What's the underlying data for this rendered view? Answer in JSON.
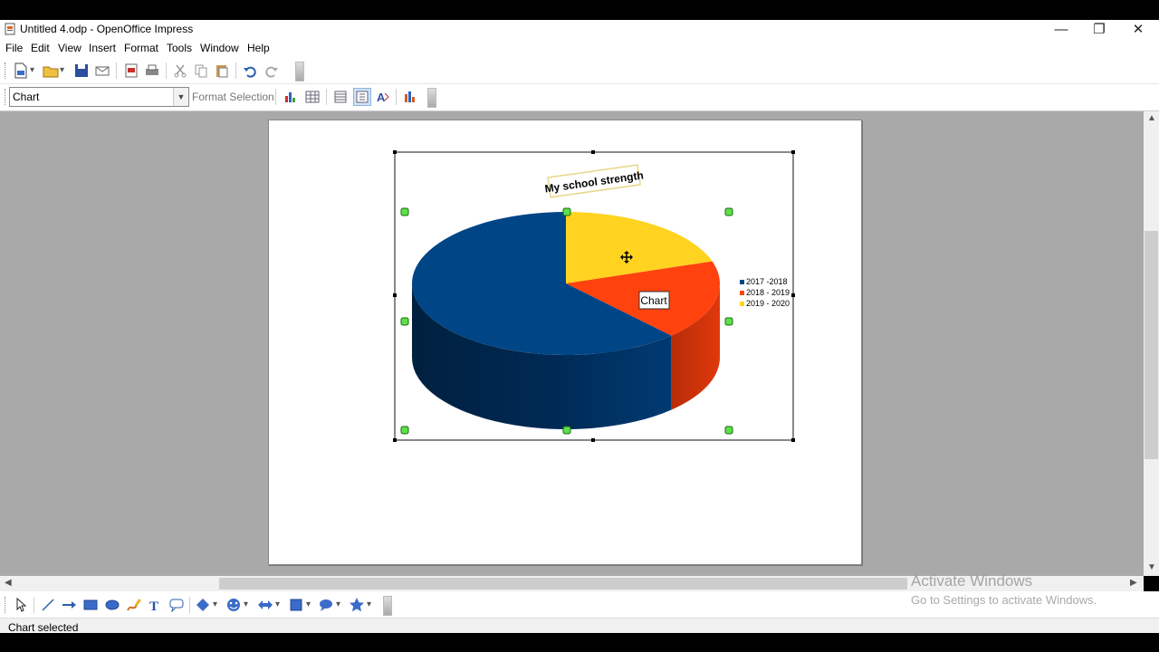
{
  "window": {
    "title": "Untitled 4.odp - OpenOffice Impress",
    "minimize_glyph": "—",
    "restore_glyph": "❐",
    "close_glyph": "✕"
  },
  "menu": [
    {
      "label": "File"
    },
    {
      "label": "Edit"
    },
    {
      "label": "View"
    },
    {
      "label": "Insert"
    },
    {
      "label": "Format"
    },
    {
      "label": "Tools"
    },
    {
      "label": "Window"
    },
    {
      "label": "Help"
    }
  ],
  "chart_toolbar": {
    "element_select_value": "Chart",
    "format_selection_label": "Format Selection"
  },
  "chart_data": {
    "type": "pie",
    "title": "My school strength",
    "categories": [
      "2017 -2018",
      "2018 - 2019",
      "2019 - 2020"
    ],
    "values": [
      62,
      18,
      20
    ],
    "colors": [
      "#004586",
      "#ff420e",
      "#ffd320"
    ],
    "legend_position": "right",
    "tooltip": "Chart"
  },
  "status": {
    "text": "Chart selected"
  },
  "watermark": {
    "line1": "Activate Windows",
    "line2": "Go to Settings to activate Windows."
  }
}
